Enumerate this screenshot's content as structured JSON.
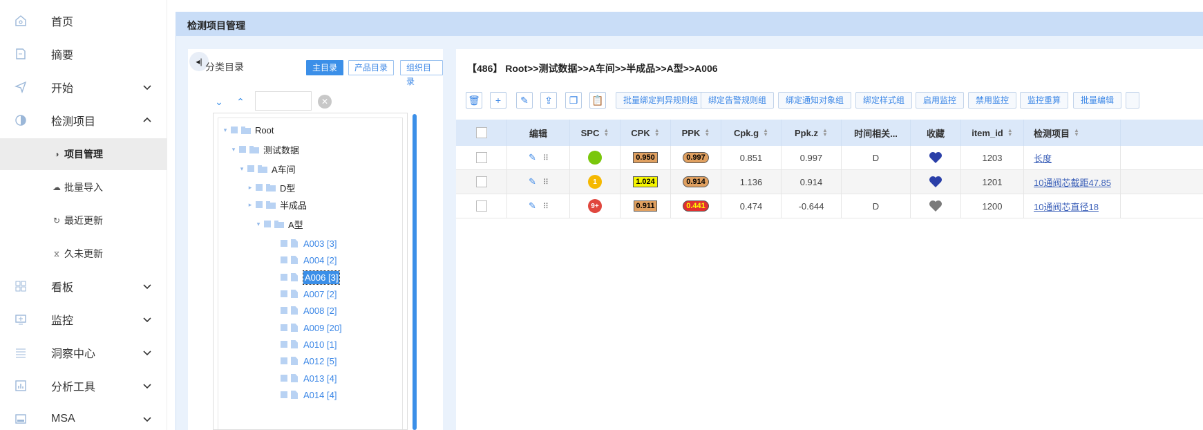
{
  "sidebar": {
    "items": [
      {
        "label": "首页",
        "icon": "home-icon"
      },
      {
        "label": "摘要",
        "icon": "document-icon"
      },
      {
        "label": "开始",
        "icon": "send-icon"
      },
      {
        "label": "检测项目",
        "icon": "half-circle-icon"
      },
      {
        "label": "看板",
        "icon": "dashboard-icon"
      },
      {
        "label": "监控",
        "icon": "monitor-icon"
      },
      {
        "label": "洞察中心",
        "icon": "list-icon"
      },
      {
        "label": "分析工具",
        "icon": "chart-icon"
      },
      {
        "label": "MSA",
        "icon": "msa-icon"
      }
    ],
    "sub_items": [
      {
        "label": "项目管理",
        "icon": "◑"
      },
      {
        "label": "批量导入",
        "icon": "☁"
      },
      {
        "label": "最近更新",
        "icon": "↻"
      },
      {
        "label": "久未更新",
        "icon": "⧖"
      }
    ]
  },
  "main": {
    "title": "检测项目管理"
  },
  "catalog": {
    "title": "分类目录",
    "tabs": [
      "主目录",
      "产品目录",
      "组织目录"
    ],
    "search_value": "",
    "tree": [
      {
        "label": "Root",
        "level": 0
      },
      {
        "label": "测试数据",
        "level": 1
      },
      {
        "label": "A车间",
        "level": 2
      },
      {
        "label": "D型",
        "level": 3
      },
      {
        "label": "半成品",
        "level": 3
      },
      {
        "label": "A型",
        "level": 4
      },
      {
        "label": "A003 [3]",
        "level": 5
      },
      {
        "label": "A004 [2]",
        "level": 5
      },
      {
        "label": "A006 [3]",
        "level": 5
      },
      {
        "label": "A007 [2]",
        "level": 5
      },
      {
        "label": "A008 [2]",
        "level": 5
      },
      {
        "label": "A009 [20]",
        "level": 5
      },
      {
        "label": "A010 [1]",
        "level": 5
      },
      {
        "label": "A012 [5]",
        "level": 5
      },
      {
        "label": "A013 [4]",
        "level": 5
      },
      {
        "label": "A014 [4]",
        "level": 5
      }
    ]
  },
  "right": {
    "breadcrumb": "【486】 Root>>测试数据>>A车间>>半成品>>A型>>A006",
    "toolbar": {
      "buttons": [
        "批量绑定判异规则组",
        "绑定告警规则组",
        "绑定通知对象组",
        "绑定样式组",
        "启用监控",
        "禁用监控",
        "监控重算",
        "批量编辑"
      ]
    },
    "table": {
      "headers": [
        "编辑",
        "SPC",
        "CPK",
        "PPK",
        "Cpk.g",
        "Ppk.z",
        "时间相关...",
        "收藏",
        "item_id",
        "检测项目"
      ],
      "rows": [
        {
          "spc": "",
          "spc_color": "#7ac70c",
          "cpk": "0.950",
          "cpk_color": "#e0a060",
          "ppk": "0.997",
          "ppk_color": "#e0a060",
          "cpkg": "0.851",
          "ppkz": "0.997",
          "time": "D",
          "fav_color": "#2a3fa8",
          "item_id": "1203",
          "name": "长度"
        },
        {
          "spc": "1",
          "spc_color": "#f5b800",
          "cpk": "1.024",
          "cpk_color": "#f5f500",
          "ppk": "0.914",
          "ppk_color": "#e0a060",
          "cpkg": "1.136",
          "ppkz": "0.914",
          "time": "",
          "fav_color": "#2a3fa8",
          "item_id": "1201",
          "name": "10通阀芯截距47.85"
        },
        {
          "spc": "9+",
          "spc_color": "#e0473e",
          "cpk": "0.911",
          "cpk_color": "#e0a060",
          "ppk": "0.441",
          "ppk_color": "#e03030",
          "cpkg": "0.474",
          "ppkz": "-0.644",
          "time": "D",
          "fav_color": "#7a7a7a",
          "item_id": "1200",
          "name": "10通阀芯直径18"
        }
      ]
    }
  }
}
